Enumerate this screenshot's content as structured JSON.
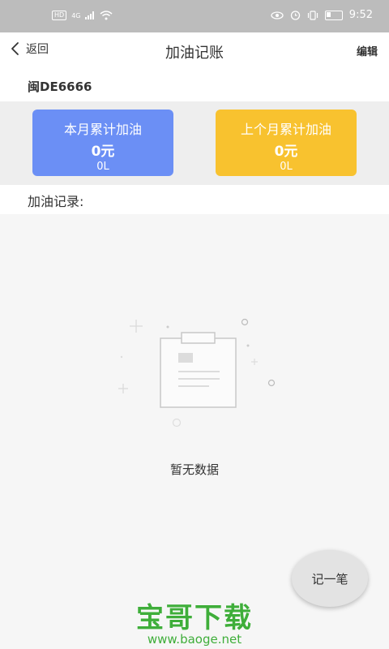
{
  "status_bar": {
    "left_chip": "HD",
    "network": "4G",
    "time": "9:52"
  },
  "nav": {
    "back_label": "返回",
    "title": "加油记账",
    "edit_label": "编辑"
  },
  "plate": "闽DE6666",
  "cards": {
    "this_month": {
      "title": "本月累计加油",
      "amount": "0元",
      "volume": "0L",
      "color": "#6b8ff5"
    },
    "last_month": {
      "title": "上个月累计加油",
      "amount": "0元",
      "volume": "0L",
      "color": "#f8c22f"
    }
  },
  "records_label": "加油记录:",
  "empty_text": "暂无数据",
  "fab_label": "记一笔",
  "watermark": {
    "logo": "宝哥下载",
    "url": "www.baoge.net"
  },
  "icons": [
    "chevron-left-icon",
    "clipboard-empty-icon",
    "eye-icon",
    "alarm-icon",
    "vibrate-icon",
    "battery-icon",
    "wifi-icon",
    "signal-icon"
  ]
}
